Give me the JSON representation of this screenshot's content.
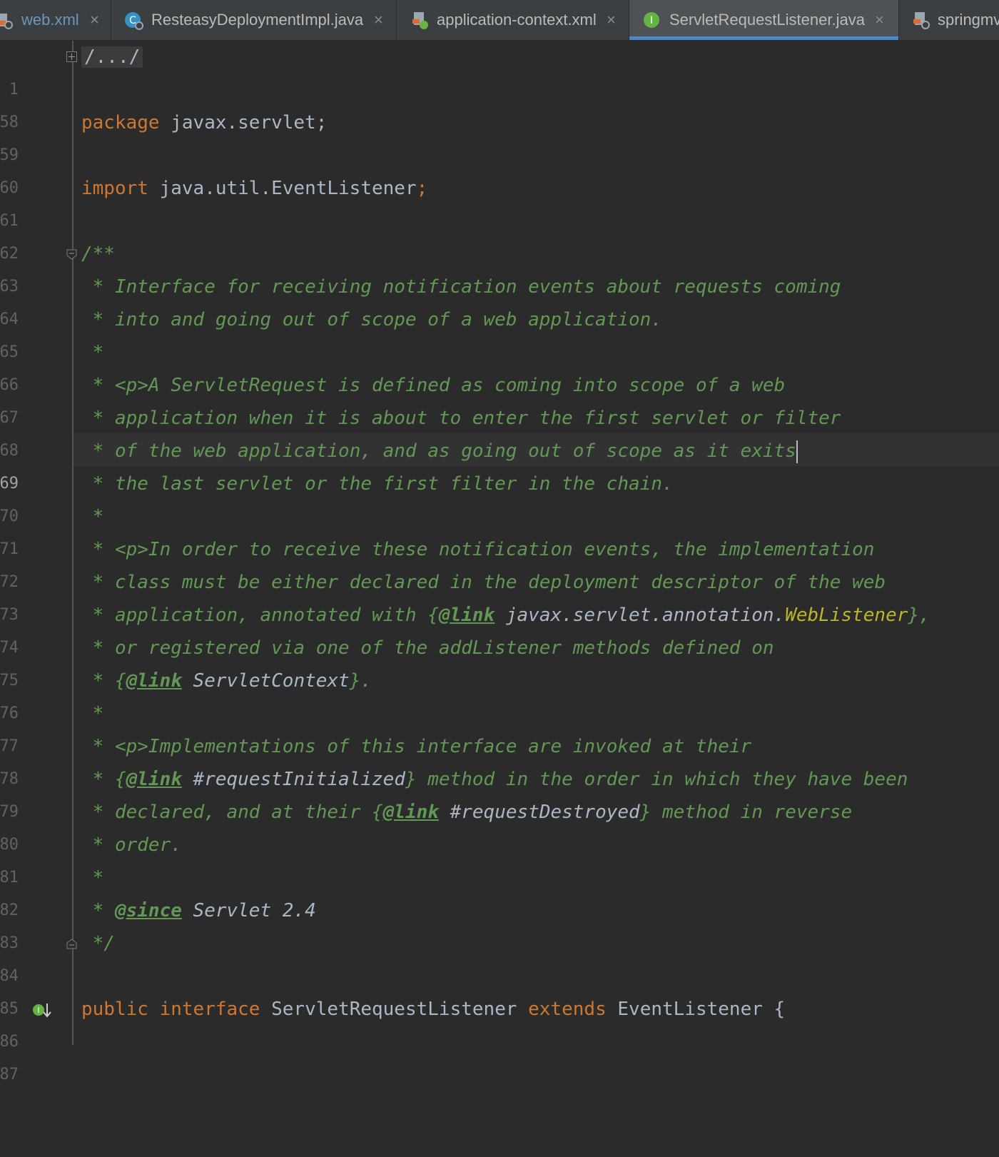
{
  "tabs": [
    {
      "label": "web.xml",
      "icon": "xml-file-icon",
      "active": false
    },
    {
      "label": "ResteasyDeploymentImpl.java",
      "icon": "java-class-icon",
      "active": false
    },
    {
      "label": "application-context.xml",
      "icon": "spring-xml-file-icon",
      "active": false
    },
    {
      "label": "ServletRequestListener.java",
      "icon": "java-interface-icon",
      "active": true
    },
    {
      "label": "springmv",
      "icon": "xml-file-icon",
      "active": false
    }
  ],
  "close_glyph": "×",
  "editor": {
    "line_numbers": [
      "1",
      "58",
      "59",
      "60",
      "61",
      "62",
      "63",
      "64",
      "65",
      "66",
      "67",
      "68",
      "69",
      "70",
      "71",
      "72",
      "73",
      "74",
      "75",
      "76",
      "77",
      "78",
      "79",
      "80",
      "81",
      "82",
      "83",
      "84",
      "85",
      "86",
      "87"
    ],
    "current_line": "69",
    "folded_header": "/.../",
    "package_kw": "package",
    "package_name": "javax.servlet;",
    "import_kw": "import",
    "import_name": "java.util.EventListener",
    "semicolon": ";",
    "doc_open": "/**",
    "doc_close": " */",
    "star": " * ",
    "star_only": " *",
    "l64": "Interface for receiving notification events about requests coming",
    "l65": "into and going out of scope of a web application.",
    "l67": "<p>A ServletRequest is defined as coming into scope of a web",
    "l68": "application when it is about to enter the first servlet or filter",
    "l69": "of the web application, and as going out of scope as it exits",
    "l70": "the last servlet or the first filter in the chain.",
    "l72": "<p>In order to receive these notification events, the implementation",
    "l73": "class must be either declared in the deployment descriptor of the web",
    "l74_a": "application, annotated with {",
    "link_tag": "@link",
    "l74_ref": " javax.servlet.annotation.",
    "l74_ann": "WebListener",
    "l74_b": "},",
    "l75": "or registered via one of the addListener methods defined on",
    "l76_a": "{",
    "l76_ref": " ServletContext",
    "l76_b": "}.",
    "l78": "<p>Implementations of this interface are invoked at their",
    "l79_a": "{",
    "l79_ref": " #requestInitialized",
    "l79_b": "} method in the order in which they have been",
    "l80_a": "declared, and at their {",
    "l80_ref": " #requestDestroyed",
    "l80_b": "} method in reverse",
    "l81": "order.",
    "since_tag": "@since",
    "l83_ref": " Servlet 2.4",
    "l86_public": "public",
    "l86_interface": "interface",
    "l86_name": "ServletRequestListener",
    "l86_extends": "extends",
    "l86_super": "EventListener",
    "l86_brace": "{"
  },
  "colors": {
    "background": "#2b2b2b",
    "keyword": "#cc7832",
    "javadoc": "#629755",
    "identifier": "#a9b7c6",
    "annotation": "#bbb529",
    "active_tab_underline": "#4a88c7"
  }
}
